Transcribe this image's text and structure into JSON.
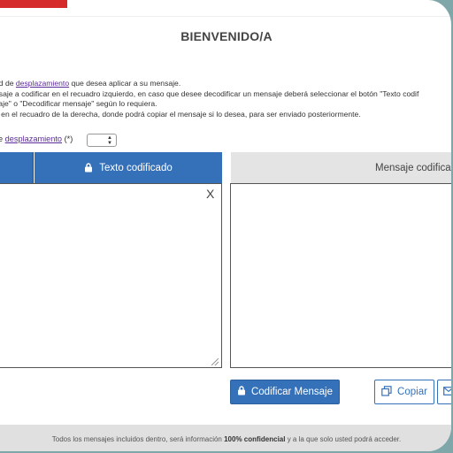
{
  "header": {
    "title": "BIENVENIDO/A"
  },
  "instructions": {
    "line1_pre": "ad de ",
    "line1_link": "desplazamiento",
    "line1_post": " que desea aplicar a su mensaje.",
    "line2": "nsaje a codificar en el recuadro izquierdo, en caso que desee decodificar un mensaje deberá seleccionar el botón \"Texto codif",
    "line3": "saje\" o \"Decodificar mensaje\" según lo requiera.",
    "line4": "á en el recuadro de la derecha, donde podrá copiar el mensaje si lo desea, para ser enviado posteriormente."
  },
  "shift": {
    "prefix": "e ",
    "link": "desplazamiento",
    "suffix": " (*)"
  },
  "tabs": {
    "coded_label": "Texto codificado",
    "right_label": "Mensaje codifica"
  },
  "input": {
    "clear_label": "X"
  },
  "buttons": {
    "encode_label": "Codificar Mensaje",
    "copy_label": "Copiar"
  },
  "footer": {
    "pre": "Todos los mensajes incluidos dentro, será información ",
    "bold": "100% confidencial",
    "post": " y a la que solo usted podrá acceder."
  },
  "colors": {
    "accent": "#3571b9",
    "brand_red": "#d62b2b",
    "link": "#5b2a9b"
  }
}
